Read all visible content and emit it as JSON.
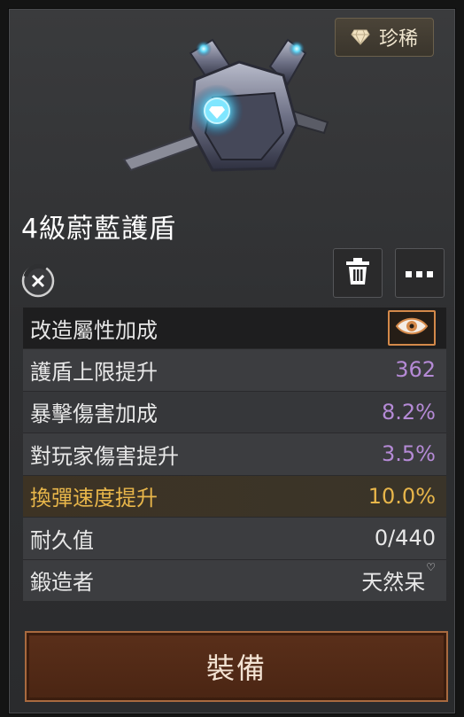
{
  "rarity": {
    "label": "珍稀",
    "icon": "diamond-icon"
  },
  "item": {
    "name": "4級蔚藍護盾",
    "image": "armor-vest-image"
  },
  "actions": {
    "untradable_icon": "untradable-icon",
    "delete_icon": "trash-icon",
    "more_icon": "more-dots-icon"
  },
  "stats": {
    "header_label": "改造屬性加成",
    "header_icon": "eye-icon",
    "rows": [
      {
        "name": "護盾上限提升",
        "value": "362",
        "tone": "purple"
      },
      {
        "name": "暴擊傷害加成",
        "value": "8.2%",
        "tone": "purple"
      },
      {
        "name": "對玩家傷害提升",
        "value": "3.5%",
        "tone": "purple"
      },
      {
        "name": "換彈速度提升",
        "value": "10.0%",
        "tone": "gold"
      },
      {
        "name": "耐久值",
        "value": "0/440",
        "tone": "white"
      }
    ],
    "forger_label": "鍛造者",
    "forger_value": "天然呆",
    "forger_suffix": "♡"
  },
  "equip_button": {
    "label": "裝備"
  },
  "colors": {
    "purple": "#b58ad6",
    "gold": "#e8b64a",
    "accent": "#d4894a"
  }
}
